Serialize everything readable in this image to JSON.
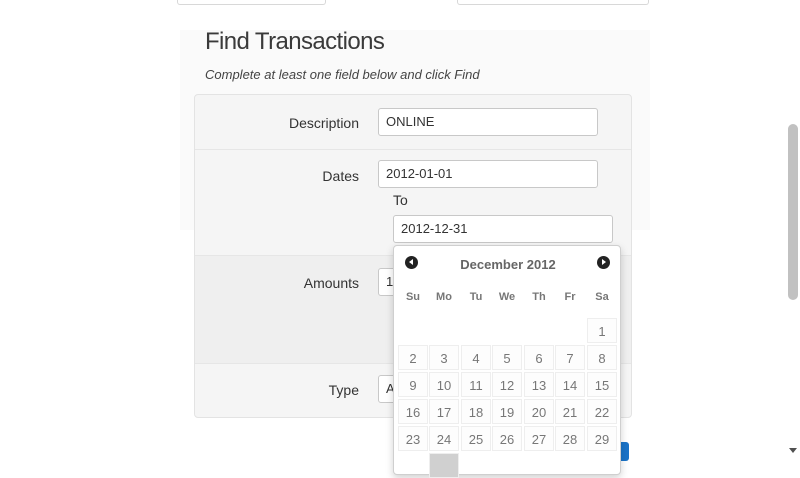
{
  "header": {
    "title": "Find Transactions",
    "subtitle": "Complete at least one field below and click Find"
  },
  "form": {
    "description_label": "Description",
    "description_value": "ONLINE",
    "dates_label": "Dates",
    "from_date": "2012-01-01",
    "to_label": "To",
    "to_date": "2012-12-31",
    "amounts_label": "Amounts",
    "amount_value": "1",
    "type_label": "Type",
    "type_value": "A"
  },
  "datepicker": {
    "month_title": "December 2012",
    "weekdays": [
      "Su",
      "Mo",
      "Tu",
      "We",
      "Th",
      "Fr",
      "Sa"
    ],
    "weeks": [
      [
        "",
        "",
        "",
        "",
        "",
        "",
        "1"
      ],
      [
        "2",
        "3",
        "4",
        "5",
        "6",
        "7",
        "8"
      ],
      [
        "9",
        "10",
        "11",
        "12",
        "13",
        "14",
        "15"
      ],
      [
        "16",
        "17",
        "18",
        "19",
        "20",
        "21",
        "22"
      ],
      [
        "23",
        "24",
        "25",
        "26",
        "27",
        "28",
        "29"
      ]
    ]
  },
  "colors": {
    "accent": "#1a73c8",
    "panel_bg": "#f5f5f5"
  }
}
